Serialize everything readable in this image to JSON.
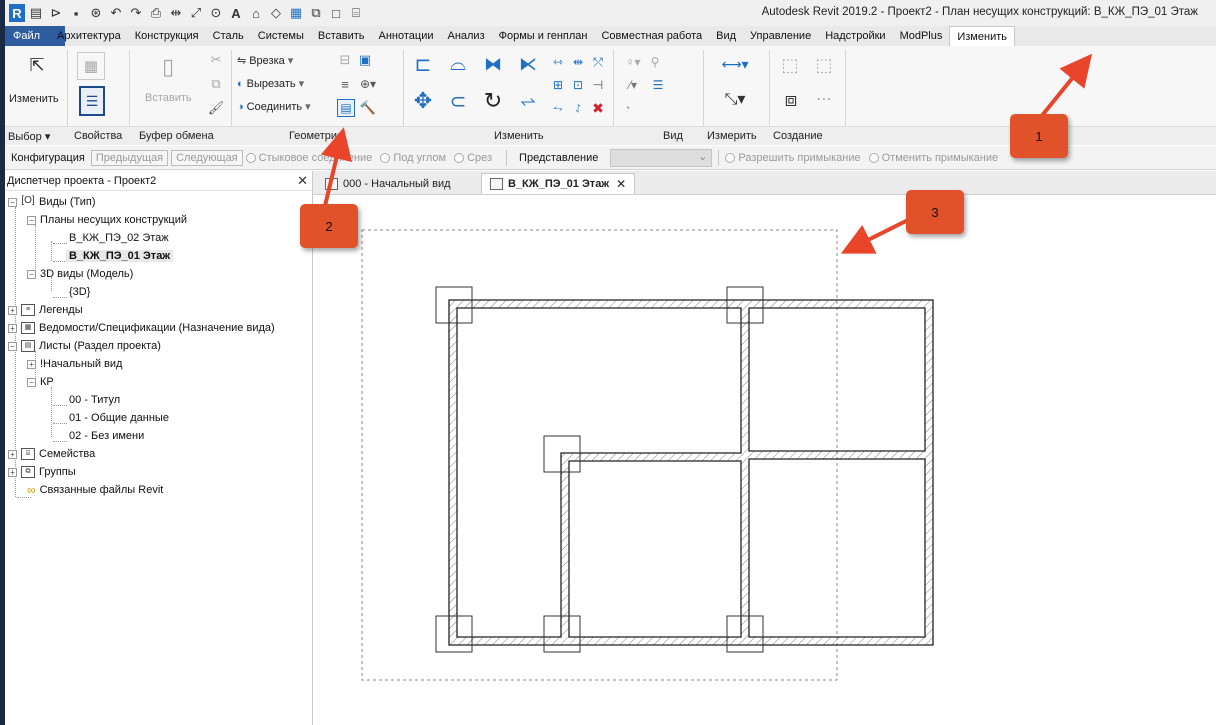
{
  "window": {
    "title": "Autodesk Revit 2019.2 - Проект2 - План несущих конструкций: В_КЖ_ПЭ_01 Этаж"
  },
  "quick_access": {
    "logo": "R",
    "icons": [
      "document-icon",
      "open-icon",
      "save-icon",
      "sync-icon",
      "undo-icon",
      "redo-icon",
      "print-icon",
      "measure-icon",
      "dimension-icon",
      "tag-icon",
      "text-icon",
      "3d-view-icon",
      "section-icon",
      "thin-lines-icon",
      "close-hidden-icon",
      "switch-windows-icon",
      "customize-icon"
    ]
  },
  "ribbon_tabs": [
    "Файл",
    "Архитектура",
    "Конструкция",
    "Сталь",
    "Системы",
    "Вставить",
    "Аннотации",
    "Анализ",
    "Формы и генплан",
    "Совместная работа",
    "Вид",
    "Управление",
    "Надстройки",
    "ModPlus",
    "Изменить"
  ],
  "active_tab": "Изменить",
  "ribbon": {
    "select_label": "Изменить",
    "properties_label": "Свойства",
    "paste_label": "Вставить",
    "cope_label": "Врезка",
    "cut_label": "Вырезать",
    "join_label": "Соединить",
    "panels": {
      "select": "Выбор",
      "properties": "Свойства",
      "clipboard": "Буфер обмена",
      "geometry": "Геометрия",
      "modify": "Изменить",
      "view": "Вид",
      "measure": "Измерить",
      "create": "Создание"
    }
  },
  "options_bar": {
    "config_label": "Конфигурация",
    "prev_label": "Предыдущая",
    "next_label": "Следующая",
    "radio_butt": "Стыковое соединение",
    "radio_miter": "Под углом",
    "radio_square": "Срез",
    "display_label": "Представление",
    "radio_allow": "Разрешить примыкание",
    "radio_disallow": "Отменить примыкание"
  },
  "project_browser": {
    "title": "Диспетчер проекта - Проект2",
    "views": "Виды (Тип)",
    "structural_plans": "Планы несущих конструкций",
    "plan_02": "В_КЖ_ПЭ_02 Этаж",
    "plan_01": "В_КЖ_ПЭ_01 Этаж",
    "views_3d": "3D виды (Модель)",
    "view_3d": "{3D}",
    "legends": "Легенды",
    "schedules": "Ведомости/Спецификации (Назначение вида)",
    "sheets": "Листы (Раздел проекта)",
    "start_view": "!Начальный вид",
    "kr": "КР",
    "sheet_00": "00 - Титул",
    "sheet_01": "01 - Общие данные",
    "sheet_02": "02 - Без имени",
    "families": "Семейства",
    "groups": "Группы",
    "links": "Связанные файлы Revit"
  },
  "doc_tabs": [
    {
      "label": "000 - Начальный вид",
      "active": false
    },
    {
      "label": "В_КЖ_ПЭ_01 Этаж",
      "active": true
    }
  ],
  "callouts": [
    "1",
    "2",
    "3"
  ],
  "colors": {
    "file_tab": "#2f5c9e",
    "callout": "#e2522a",
    "arrow": "#e8452a",
    "revit_blue": "#1f6fc5"
  }
}
